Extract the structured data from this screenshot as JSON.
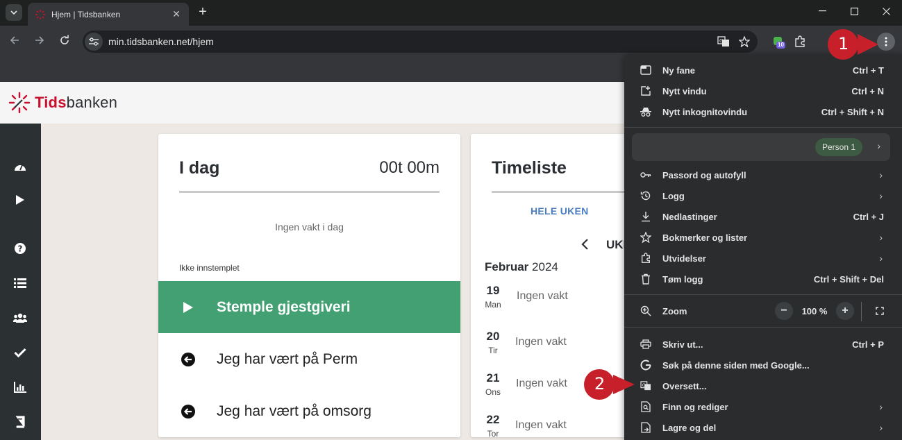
{
  "browser": {
    "tab_title": "Hjem | Tidsbanken",
    "url": "min.tidsbanken.net/hjem",
    "extension_badge": "10",
    "colors": {
      "frame": "#1f2020",
      "toolbar": "#35363a",
      "menu": "#2b2c2e"
    }
  },
  "app": {
    "logo_tids": "Tids",
    "logo_banken": "banken",
    "brand_color": "#c8102e",
    "sidebar_icons": [
      "dashboard-icon",
      "play-icon",
      "help-icon",
      "list-icon",
      "users-icon",
      "check-icon",
      "chart-icon",
      "book-icon"
    ]
  },
  "today": {
    "title": "I dag",
    "hours": "00t 00m",
    "no_shift": "Ingen vakt i dag",
    "status": "Ikke innstemplet",
    "actions": [
      {
        "label": "Stemple gjestgiveri",
        "icon": "play-icon"
      },
      {
        "label": "Jeg har vært på Perm",
        "icon": "arrow-left-circle-icon"
      },
      {
        "label": "Jeg har vært på omsorg",
        "icon": "arrow-left-circle-icon"
      }
    ],
    "accent": "#42a072"
  },
  "timeliste": {
    "title": "Timeliste",
    "tab": "HELE UKEN",
    "week_label": "UKE",
    "month": "Februar",
    "year": "2024",
    "days": [
      {
        "num": "19",
        "name": "Man",
        "shift": "Ingen vakt"
      },
      {
        "num": "20",
        "name": "Tir",
        "shift": "Ingen vakt"
      },
      {
        "num": "21",
        "name": "Ons",
        "shift": "Ingen vakt"
      },
      {
        "num": "22",
        "name": "Tor",
        "shift": "Ingen vakt"
      }
    ]
  },
  "chrome_menu": {
    "items": [
      {
        "label": "Ny fane",
        "shortcut": "Ctrl + T",
        "icon": "new-tab-icon"
      },
      {
        "label": "Nytt vindu",
        "shortcut": "Ctrl + N",
        "icon": "new-window-icon"
      },
      {
        "label": "Nytt inkognitovindu",
        "shortcut": "Ctrl + Shift + N",
        "icon": "incognito-icon"
      }
    ],
    "profile": "Person 1",
    "items2": [
      {
        "label": "Passord og autofyll",
        "shortcut": "",
        "icon": "key-icon",
        "submenu": true
      },
      {
        "label": "Logg",
        "shortcut": "",
        "icon": "history-icon",
        "submenu": true
      },
      {
        "label": "Nedlastinger",
        "shortcut": "Ctrl + J",
        "icon": "download-icon",
        "submenu": false
      },
      {
        "label": "Bokmerker og lister",
        "shortcut": "",
        "icon": "star-icon",
        "submenu": true
      },
      {
        "label": "Utvidelser",
        "shortcut": "",
        "icon": "puzzle-icon",
        "submenu": true
      },
      {
        "label": "Tøm logg",
        "shortcut": "Ctrl + Shift + Del",
        "icon": "trash-icon",
        "submenu": false
      }
    ],
    "zoom_label": "Zoom",
    "zoom_value": "100 %",
    "items3": [
      {
        "label": "Skriv ut...",
        "shortcut": "Ctrl + P",
        "icon": "print-icon",
        "submenu": false
      },
      {
        "label": "Søk på denne siden med Google...",
        "shortcut": "",
        "icon": "google-icon",
        "submenu": false
      },
      {
        "label": "Oversett...",
        "shortcut": "",
        "icon": "translate-icon",
        "submenu": false
      },
      {
        "label": "Finn og rediger",
        "shortcut": "",
        "icon": "find-icon",
        "submenu": true
      },
      {
        "label": "Lagre og del",
        "shortcut": "",
        "icon": "save-share-icon",
        "submenu": true
      }
    ]
  },
  "callouts": [
    "1",
    "2"
  ],
  "callout_color": "#c8202a"
}
